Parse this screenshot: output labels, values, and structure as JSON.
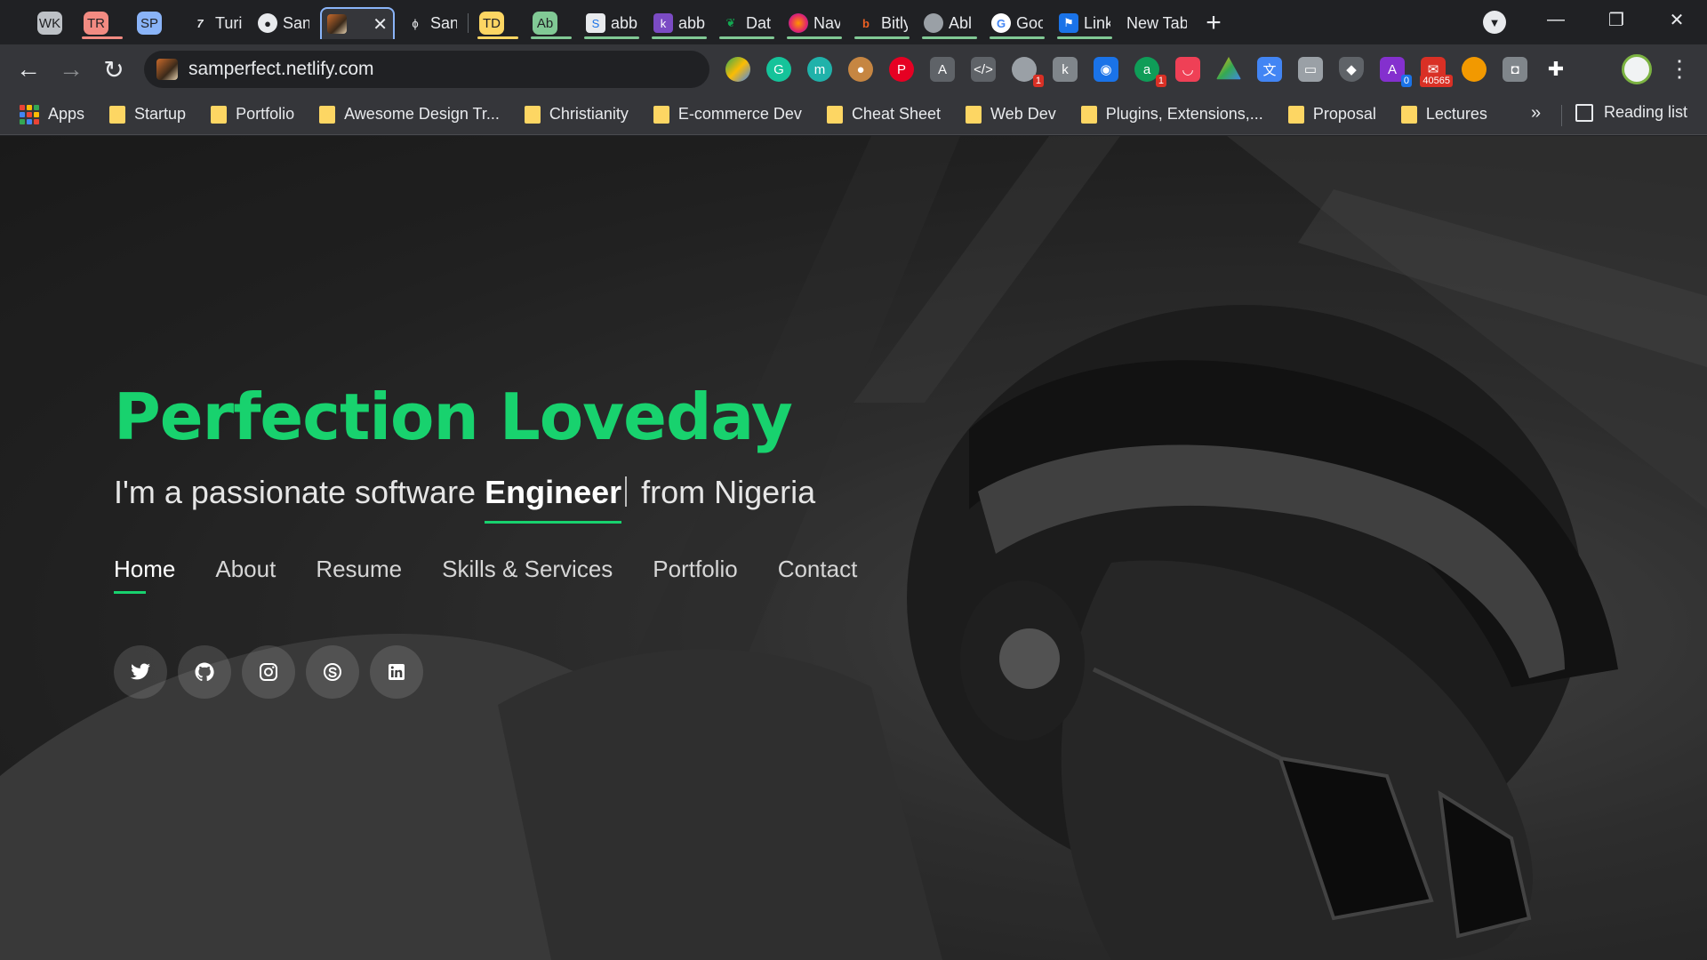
{
  "tabs": [
    {
      "label": "WK",
      "title": "",
      "fav_bg": "#bdc1c6",
      "group_color": "#bdc1c6"
    },
    {
      "label": "TR",
      "title": "",
      "fav_bg": "#f28b82",
      "group_color": "#f28b82"
    },
    {
      "label": "SP",
      "title": "",
      "fav_bg": "#8ab4f8",
      "group_color": "#8ab4f8"
    },
    {
      "label": "",
      "title": "Turi",
      "fav_bg": "",
      "group_color": "#8ab4f8"
    },
    {
      "label": "",
      "title": "San",
      "fav_bg": "",
      "group_color": "#8ab4f8"
    },
    {
      "label": "",
      "title": "",
      "fav_bg": "",
      "group_color": "#8ab4f8",
      "active": true
    },
    {
      "label": "",
      "title": "San",
      "fav_bg": "",
      "group_color": "#8ab4f8"
    },
    {
      "label": "TD",
      "title": "",
      "fav_bg": "#fdd663",
      "group_color": "#fdd663"
    },
    {
      "label": "Ab",
      "title": "",
      "fav_bg": "#81c995",
      "group_color": "#81c995"
    },
    {
      "label": "",
      "title": "abb",
      "fav_bg": "",
      "group_color": "#81c995"
    },
    {
      "label": "",
      "title": "abb",
      "fav_bg": "",
      "group_color": "#81c995"
    },
    {
      "label": "",
      "title": "Dat",
      "fav_bg": "",
      "group_color": "#81c995"
    },
    {
      "label": "",
      "title": "Nav",
      "fav_bg": "",
      "group_color": "#81c995"
    },
    {
      "label": "",
      "title": "Bitly",
      "fav_bg": "",
      "group_color": "#81c995"
    },
    {
      "label": "",
      "title": "Abl",
      "fav_bg": "",
      "group_color": "#81c995"
    },
    {
      "label": "",
      "title": "Goo",
      "fav_bg": "",
      "group_color": "#81c995"
    },
    {
      "label": "",
      "title": "Link",
      "fav_bg": "",
      "group_color": "#81c995"
    },
    {
      "label": "",
      "title": "New Tab",
      "fav_bg": "",
      "group_color": ""
    }
  ],
  "toolbar": {
    "url": "samperfect.netlify.com"
  },
  "extensions": {
    "badge_1": "1",
    "badge_2": "1",
    "badge_blue": "0",
    "gmail_count": "40565"
  },
  "bookmarks": {
    "apps": "Apps",
    "items": [
      "Startup",
      "Portfolio",
      "Awesome Design Tr...",
      "Christianity",
      "E-commerce Dev",
      "Cheat Sheet",
      "Web Dev",
      "Plugins, Extensions,...",
      "Proposal",
      "Lectures"
    ],
    "more": "»",
    "reading_list": "Reading list"
  },
  "hero": {
    "name": "Perfection Loveday",
    "tagline_pre": "I'm a passionate software ",
    "tagline_typed": "Engineer",
    "tagline_post": " from Nigeria",
    "nav": [
      "Home",
      "About",
      "Resume",
      "Skills & Services",
      "Portfolio",
      "Contact"
    ],
    "active_nav": "Home",
    "accent": "#18d26e"
  },
  "socials": [
    "twitter-icon",
    "github-icon",
    "instagram-icon",
    "skype-icon",
    "linkedin-icon"
  ]
}
